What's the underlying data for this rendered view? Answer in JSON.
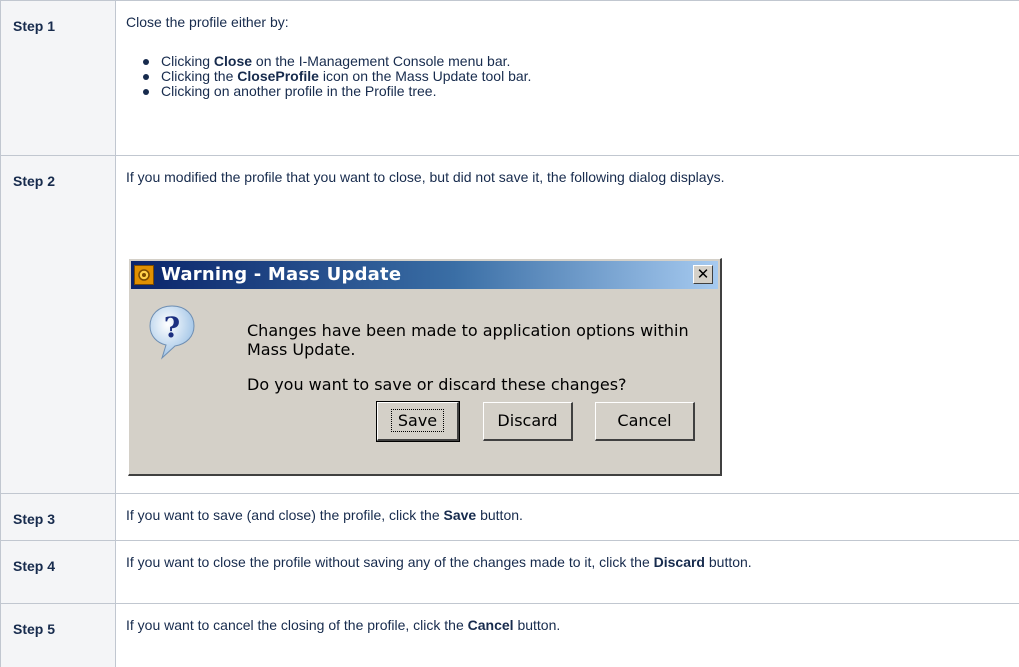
{
  "steps": [
    {
      "label": "Step 1",
      "intro": "Close the profile either by:",
      "bullets": [
        {
          "pre": "Clicking ",
          "bold": "Close",
          "post": " on the I-Management Console menu bar."
        },
        {
          "pre": "Clicking the ",
          "bold": "CloseProfile",
          "post": " icon on the Mass Update tool bar."
        },
        {
          "pre": "Clicking on another profile in the Profile tree.",
          "bold": "",
          "post": ""
        }
      ]
    },
    {
      "label": "Step 2",
      "text": "If you modified the profile that you want to close, but did not save it, the following dialog displays."
    },
    {
      "label": "Step 3",
      "pre": "If you want to save (and close) the profile, click the ",
      "bold": "Save",
      "post": " button."
    },
    {
      "label": "Step 4",
      "pre": "If you want to close the profile without saving any of the changes made to it, click the ",
      "bold": "Discard",
      "post": " button."
    },
    {
      "label": "Step 5",
      "pre": "If you want to cancel the closing of the profile, click the ",
      "bold": "Cancel",
      "post": " button."
    }
  ],
  "dialog": {
    "title": "Warning - Mass Update",
    "close_glyph": "✕",
    "message": "Changes have been made to application options within Mass Update.",
    "question": "Do you want to save or discard these changes?",
    "buttons": {
      "save": "Save",
      "discard": "Discard",
      "cancel": "Cancel"
    },
    "icons": {
      "title": "app-gear-icon",
      "message": "question-balloon-icon"
    }
  }
}
